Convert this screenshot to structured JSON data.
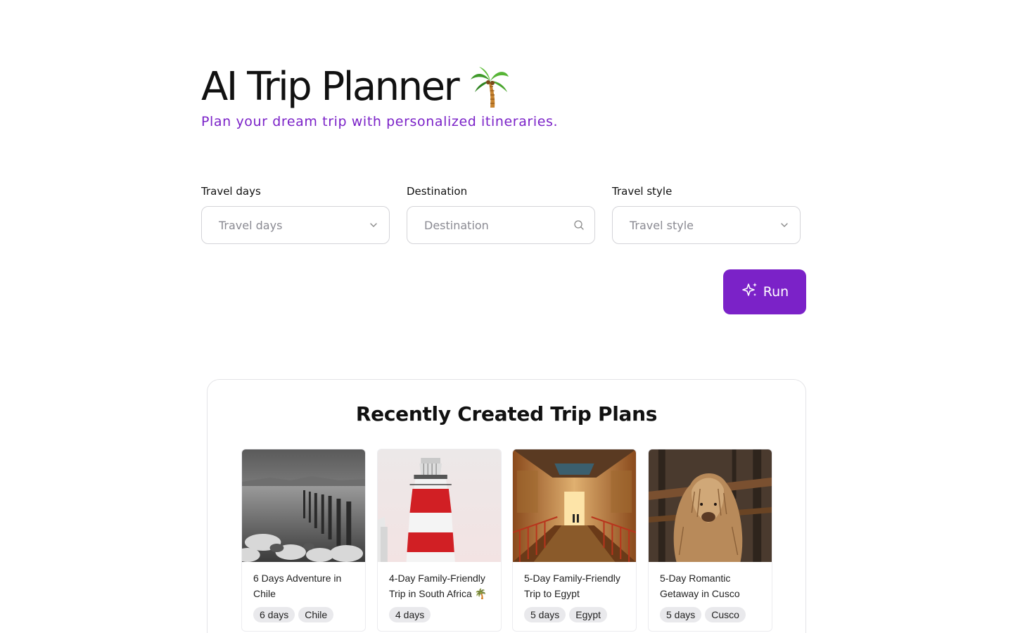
{
  "header": {
    "title": "AI Trip Planner",
    "title_icon": "palm-tree-icon",
    "subtitle": "Plan your dream trip with personalized itineraries."
  },
  "form": {
    "travel_days": {
      "label": "Travel days",
      "placeholder": "Travel days",
      "icon": "chevron-down-icon"
    },
    "destination": {
      "label": "Destination",
      "placeholder": "Destination",
      "icon": "search-icon"
    },
    "travel_style": {
      "label": "Travel style",
      "placeholder": "Travel style",
      "icon": "chevron-down-icon"
    },
    "run_button": {
      "label": "Run",
      "icon": "sparkles-icon"
    }
  },
  "recent": {
    "title": "Recently Created Trip Plans",
    "cards": [
      {
        "title": "6 Days Adventure in Chile",
        "tags": [
          "6 days",
          "Chile"
        ],
        "image": "pier-lake-bw"
      },
      {
        "title": "4-Day Family-Friendly Trip in South Africa 🌴",
        "tags": [
          "4 days"
        ],
        "image": "lighthouse"
      },
      {
        "title": "5-Day Family-Friendly Trip to Egypt",
        "tags": [
          "5 days",
          "Egypt"
        ],
        "image": "tomb-corridor"
      },
      {
        "title": "5-Day Romantic Getaway in Cusco",
        "tags": [
          "5 days",
          "Cusco"
        ],
        "image": "alpaca"
      }
    ]
  },
  "colors": {
    "accent": "#7b22c8",
    "border": "#d4d4d8",
    "placeholder": "#8a8a92",
    "tag_bg": "#e9e9ec"
  }
}
